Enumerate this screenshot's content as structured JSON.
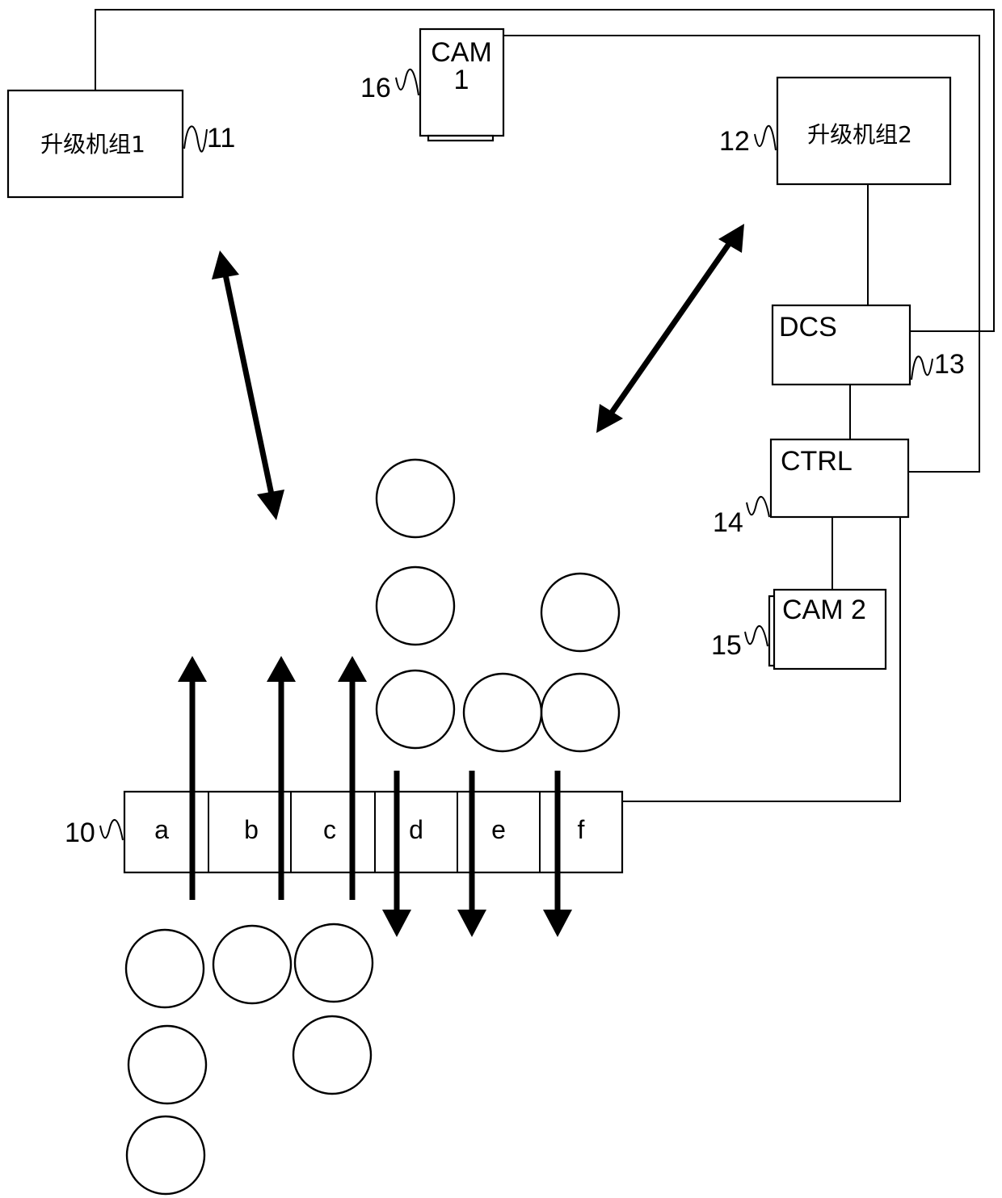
{
  "diagram": {
    "components": {
      "unit1": {
        "label": "升级机组1",
        "ref": "11"
      },
      "unit2": {
        "label": "升级机组2",
        "ref": "12"
      },
      "cam1": {
        "label_line1": "CAM",
        "label_line2": "1",
        "ref": "16"
      },
      "dcs": {
        "label": "DCS",
        "ref": "13"
      },
      "ctrl": {
        "label": "CTRL",
        "ref": "14"
      },
      "cam2": {
        "label": "CAM 2",
        "ref": "15"
      },
      "strip": {
        "ref": "10",
        "cells": [
          "a",
          "b",
          "c",
          "d",
          "e",
          "f"
        ]
      }
    },
    "flows": {
      "up_cells": [
        "a",
        "b",
        "c"
      ],
      "down_cells": [
        "d",
        "e",
        "f"
      ],
      "bidirectional": [
        "unit1-strip",
        "unit2-strip"
      ]
    },
    "circle_groups": {
      "upper_group_count": 6,
      "lower_group_count": 6
    }
  }
}
